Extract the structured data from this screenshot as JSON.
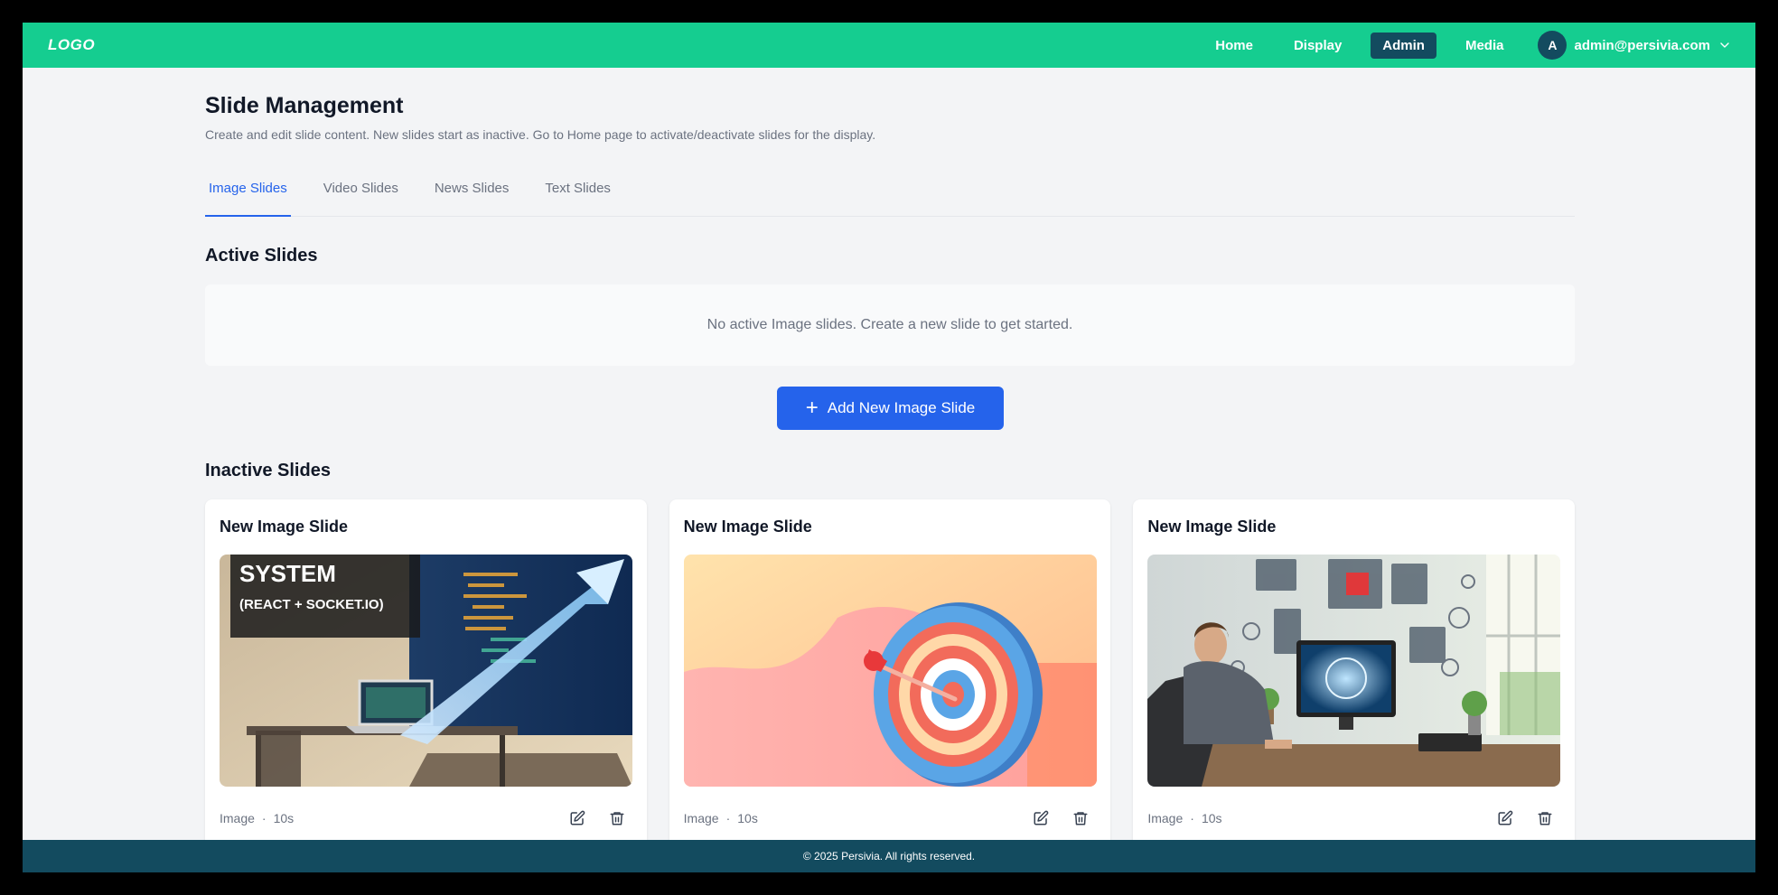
{
  "header": {
    "logo": "LOGO",
    "nav": [
      "Home",
      "Display",
      "Admin",
      "Media"
    ],
    "active_nav": "Admin",
    "user_initial": "A",
    "user_email": "admin@persivia.com"
  },
  "page": {
    "title": "Slide Management",
    "subtitle": "Create and edit slide content. New slides start as inactive. Go to Home page to activate/deactivate slides for the display."
  },
  "tabs": [
    "Image Slides",
    "Video Slides",
    "News Slides",
    "Text Slides"
  ],
  "active_tab": "Image Slides",
  "active_section": {
    "title": "Active Slides",
    "empty_message": "No active Image slides. Create a new slide to get started."
  },
  "add_button_label": "Add New Image Slide",
  "inactive_section": {
    "title": "Inactive Slides",
    "cards": [
      {
        "title": "New Image Slide",
        "type": "Image",
        "duration": "10s",
        "overlay_line1": "SYSTEM",
        "overlay_line2": "(REACT + SOCKET.IO)"
      },
      {
        "title": "New Image Slide",
        "type": "Image",
        "duration": "10s"
      },
      {
        "title": "New Image Slide",
        "type": "Image",
        "duration": "10s"
      }
    ]
  },
  "footer": "© 2025 Persivia. All rights reserved.",
  "colors": {
    "header_bg": "#15cd90",
    "dark_accent": "#134b5f",
    "primary": "#2563eb"
  }
}
